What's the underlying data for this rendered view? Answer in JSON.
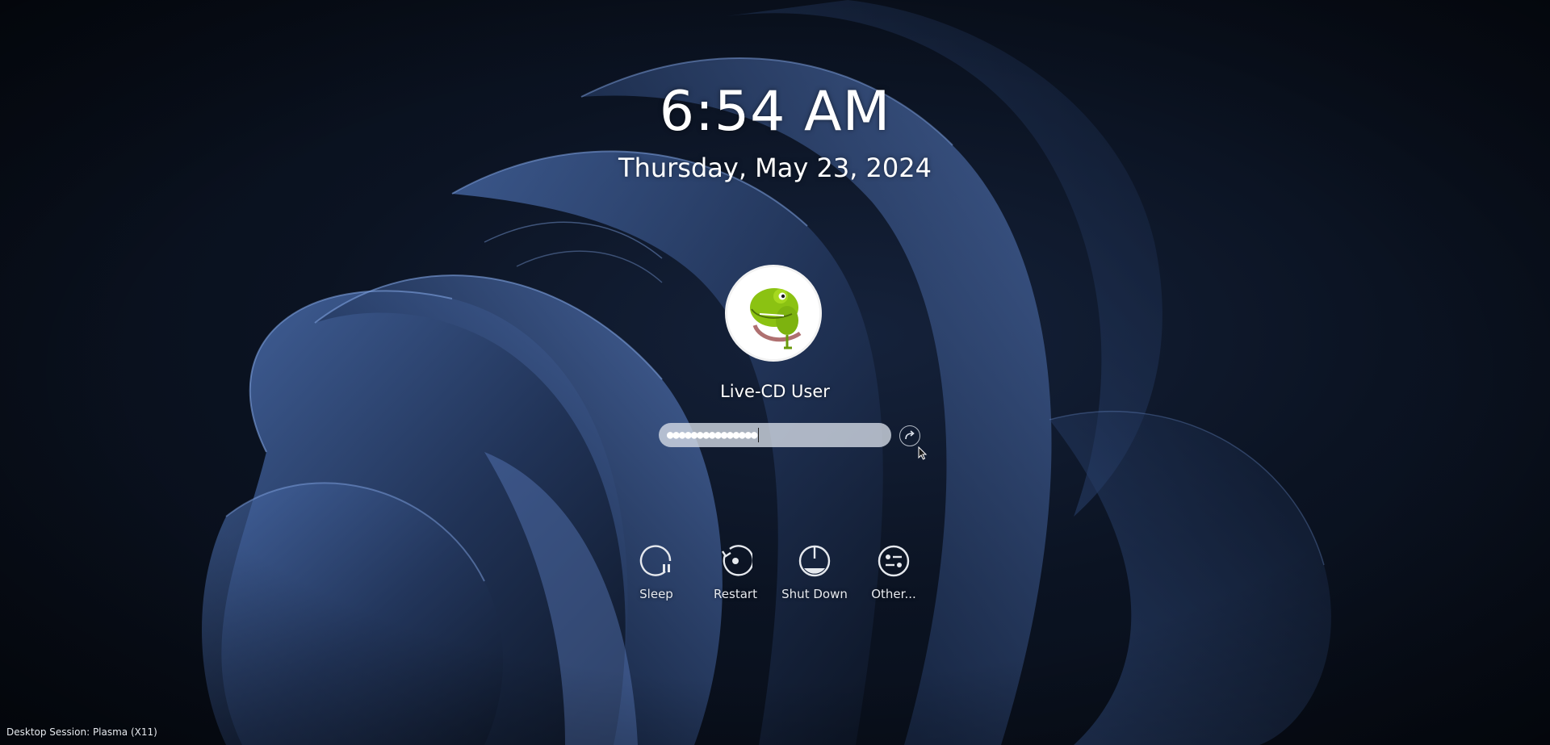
{
  "lock_screen": {
    "time": "6:54 AM",
    "date": "Thursday, May 23, 2024",
    "user": {
      "name": "Live-CD User",
      "avatar_icon": "chameleon-mascot-icon"
    },
    "password": {
      "masked_value": "●●●●●●●●●●●●●●●",
      "login_icon": "arrow-right-icon"
    },
    "actions": [
      {
        "label": "Sleep",
        "icon": "sleep-icon"
      },
      {
        "label": "Restart",
        "icon": "restart-icon"
      },
      {
        "label": "Shut Down",
        "icon": "shutdown-icon"
      },
      {
        "label": "Other...",
        "icon": "other-icon"
      }
    ],
    "session": "Desktop Session: Plasma (X11)"
  },
  "colors": {
    "background_dark": "#070c16",
    "wallpaper_blue": "#3e5f9a",
    "field_background": "#d7dee8",
    "text": "#ffffff"
  }
}
